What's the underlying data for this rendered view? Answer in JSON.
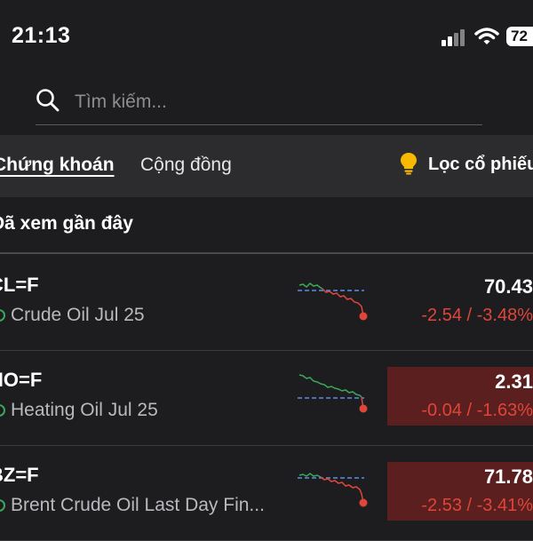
{
  "status_bar": {
    "time": "21:13",
    "battery": "72"
  },
  "search": {
    "placeholder": "Tìm kiếm..."
  },
  "tabs": [
    {
      "label": "Chứng khoán",
      "active": true
    },
    {
      "label": "Cộng đồng",
      "active": false
    }
  ],
  "screener": {
    "label": "Lọc cổ phiếu"
  },
  "section": {
    "title": "Đã xem gần đây"
  },
  "watchlist": [
    {
      "ticker": "CL=F",
      "name": "Crude Oil Jul 25",
      "price": "70.43",
      "change": "-2.54 / -3.48%",
      "highlighted": false,
      "trend": "down"
    },
    {
      "ticker": "HO=F",
      "name": "Heating Oil Jul 25",
      "price": "2.31",
      "change": "-0.04 / -1.63%",
      "highlighted": true,
      "trend": "down"
    },
    {
      "ticker": "BZ=F",
      "name": "Brent Crude Oil Last Day Fin...",
      "price": "71.78",
      "change": "-2.53 / -3.41%",
      "highlighted": true,
      "trend": "down"
    }
  ],
  "colors": {
    "background": "#1d1d1f",
    "tab_bar": "#2c2c2e",
    "positive": "#3aa85a",
    "negative": "#e0453a",
    "highlight": "#5a1f1e",
    "baseline": "#5b8ee6"
  }
}
